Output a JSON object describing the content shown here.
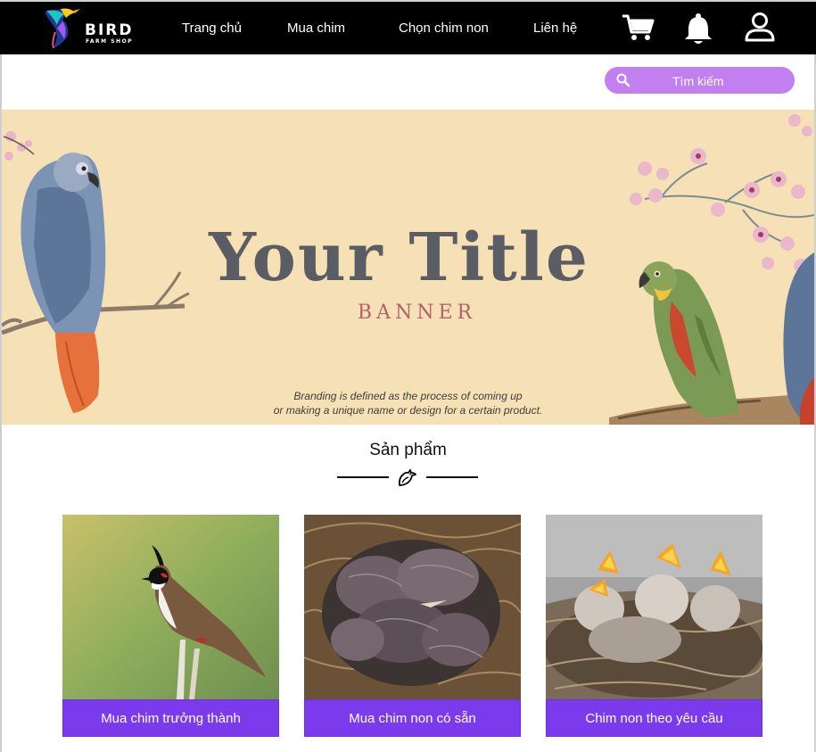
{
  "brand": {
    "name": "BIRD",
    "tagline": "FARM SHOP"
  },
  "nav": {
    "items": [
      {
        "label": "Trang chủ"
      },
      {
        "label": "Mua chim"
      },
      {
        "label": "Chọn chim non"
      },
      {
        "label": "Liên hệ"
      }
    ],
    "icons": [
      "cart-icon",
      "bell-icon",
      "user-icon"
    ]
  },
  "search": {
    "placeholder": "Tìm kiếm"
  },
  "banner": {
    "title": "Your Title",
    "subtitle": "BANNER",
    "description_line1": "Branding is defined as the process of coming up",
    "description_line2": "or making a unique name or design for a certain product."
  },
  "products": {
    "heading": "Sản phẩm",
    "cards": [
      {
        "label": "Mua chim trưởng thành"
      },
      {
        "label": "Mua chim non có sẵn"
      },
      {
        "label": "Chim non theo yêu cầu"
      }
    ]
  },
  "colors": {
    "nav_bg": "#000000",
    "accent": "#7c3aed",
    "search_bg": "#c17ff0",
    "banner_bg": "#f6e0b5"
  }
}
